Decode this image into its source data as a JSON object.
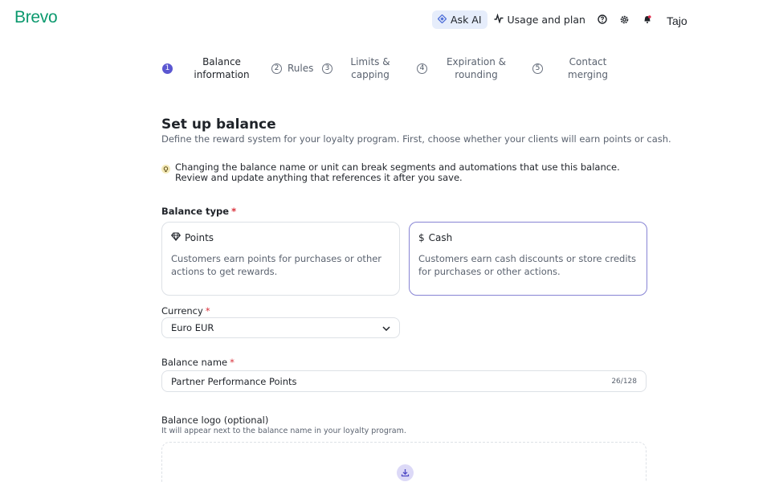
{
  "brand": {
    "logo": "Brevo",
    "accent": "#0b996e"
  },
  "header": {
    "ask_ai": "Ask AI",
    "usage": "Usage and plan",
    "icons": [
      "help-icon",
      "settings-icon",
      "notification-bell-icon"
    ],
    "user": "Tajo"
  },
  "stepper": {
    "steps": [
      {
        "num": "1",
        "label": "Balance information",
        "active": true
      },
      {
        "num": "2",
        "label": "Rules",
        "active": false
      },
      {
        "num": "3",
        "label": "Limits & capping",
        "active": false
      },
      {
        "num": "4",
        "label": "Expiration & rounding",
        "active": false
      },
      {
        "num": "5",
        "label": "Contact merging",
        "active": false
      }
    ],
    "active_color": "#5b57d1"
  },
  "page": {
    "title": "Set up balance",
    "subtitle": "Define the reward system for your loyalty program. First, choose whether your clients will earn points or cash.",
    "notice": "Changing the balance name or unit can break segments and automations that use this balance. Review and update anything that references it after you save."
  },
  "balance_type": {
    "label": "Balance type",
    "required_mark": "*",
    "options": [
      {
        "title": "Points",
        "icon": "diamond-icon",
        "description": "Customers earn points for purchases or other actions to get rewards.",
        "selected": false
      },
      {
        "title": "Cash",
        "icon": "dollar-icon",
        "description": "Customers earn cash discounts or store credits for purchases or other actions.",
        "selected": true
      }
    ]
  },
  "currency": {
    "label": "Currency",
    "required_mark": "*",
    "value": "Euro EUR"
  },
  "balance_name": {
    "label": "Balance name",
    "required_mark": "*",
    "value": "Partner Performance Points",
    "counter": "26/128"
  },
  "balance_logo": {
    "label": "Balance logo (optional)",
    "hint": "It will appear next to the balance name in your loyalty program."
  }
}
